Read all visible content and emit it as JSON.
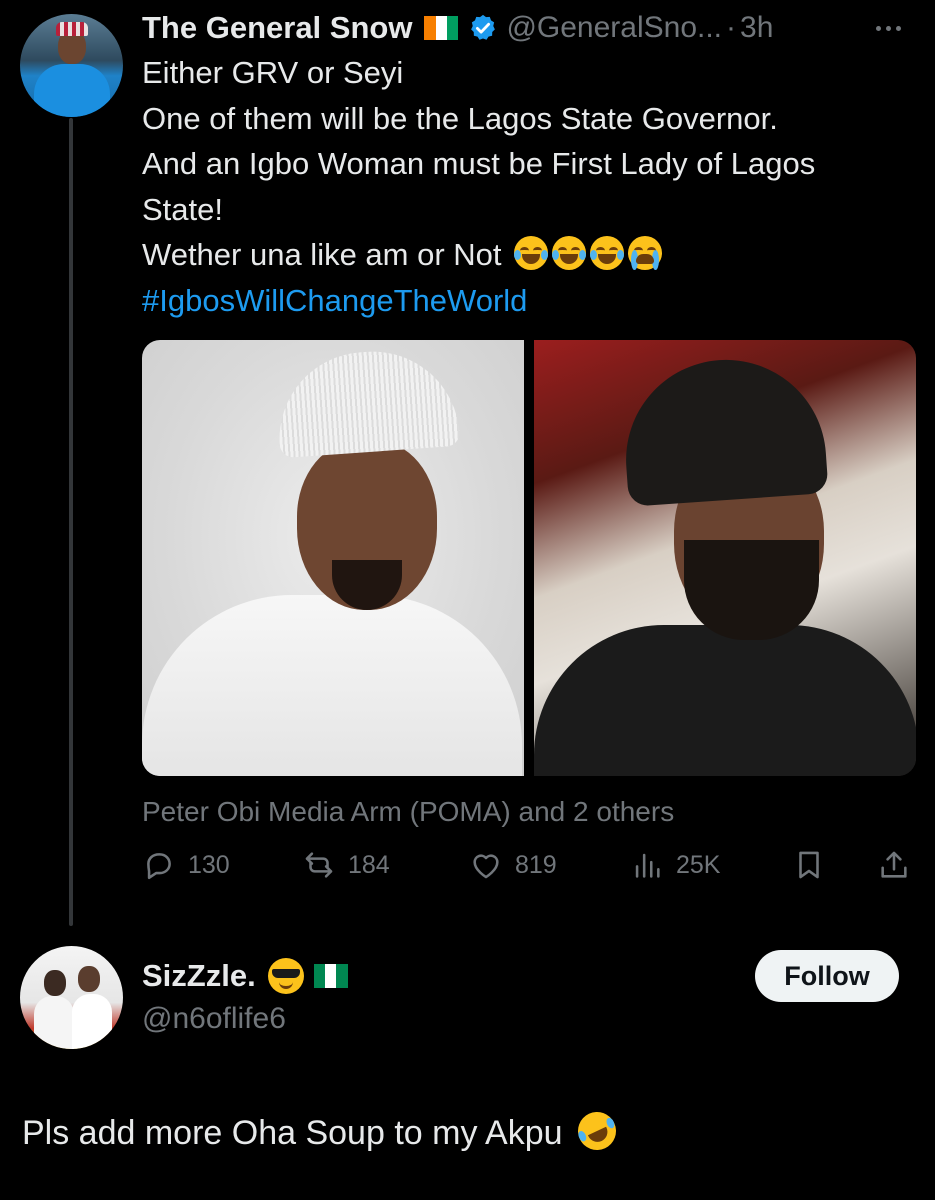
{
  "tweet": {
    "display_name": "The General Snow",
    "handle": "@GeneralSno...",
    "separator": "·",
    "time": "3h",
    "lines": [
      "Either GRV or Seyi",
      "One of them will be the Lagos State Governor.",
      "And an Igbo Woman must be First Lady of Lagos",
      "State!",
      "Wether una like am or Not"
    ],
    "hashtag": "#IgbosWillChangeTheWorld",
    "reposted_by": "Peter Obi Media Arm (POMA) and 2 others",
    "stats": {
      "replies": "130",
      "reposts": "184",
      "likes": "819",
      "views": "25K"
    }
  },
  "reply": {
    "display_name": "SizZzle.",
    "handle": "@n6oflife6",
    "follow_label": "Follow",
    "text": "Pls add more Oha Soup to my Akpu"
  },
  "colors": {
    "background": "#000000",
    "text": "#e7e9ea",
    "secondary": "#71767b",
    "link": "#1d9bf0",
    "verified": "#1d9bf0",
    "follow_bg": "#eff3f4"
  },
  "icons": [
    "reply-icon",
    "repost-icon",
    "like-icon",
    "views-icon",
    "bookmark-icon",
    "share-icon",
    "more-icon",
    "verified-badge-icon"
  ]
}
